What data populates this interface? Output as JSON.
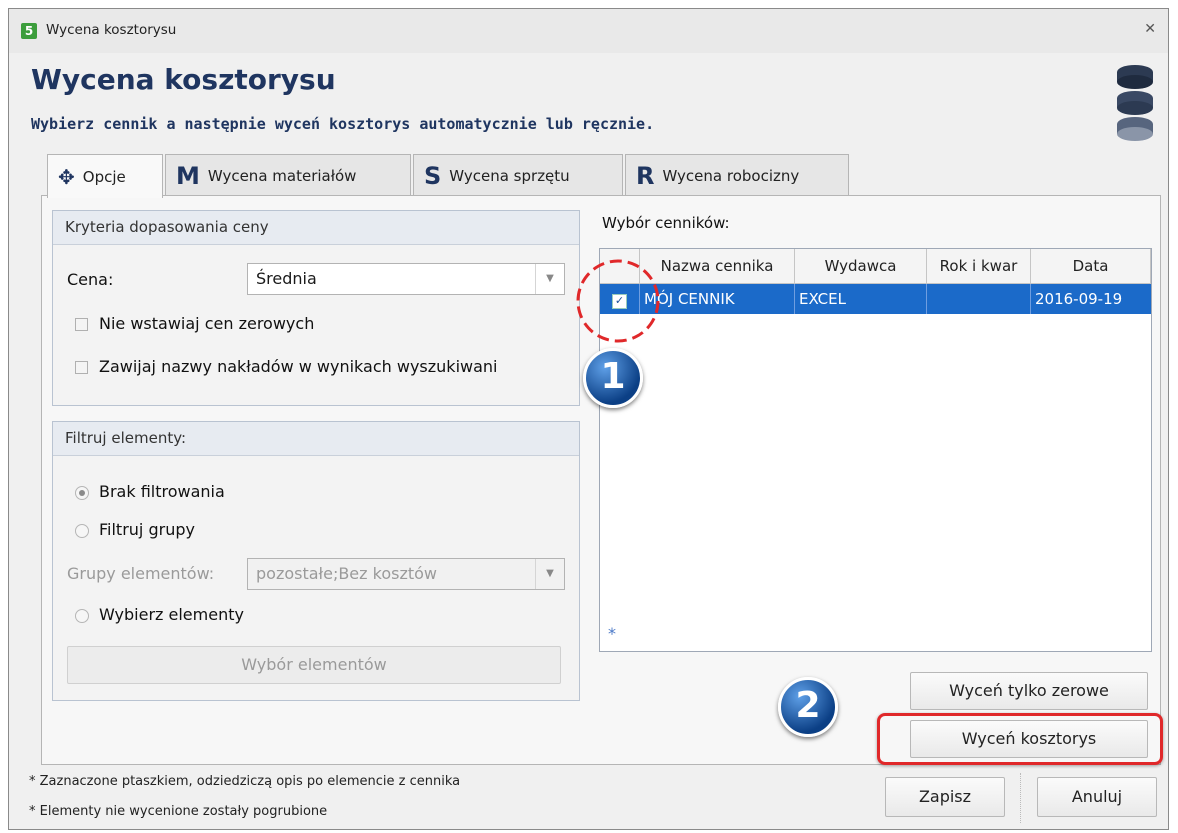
{
  "window": {
    "title": "Wycena kosztorysu",
    "app_icon": "5",
    "close_glyph": "✕"
  },
  "header": {
    "title": "Wycena kosztorysu",
    "subtitle": "Wybierz cennik a następnie wyceń kosztorys automatycznie lub ręcznie."
  },
  "tabs": [
    {
      "label": "Opcje",
      "icon": "✥"
    },
    {
      "label": "Wycena materiałów",
      "icon": "M"
    },
    {
      "label": "Wycena sprzętu",
      "icon": "S"
    },
    {
      "label": "Wycena robocizny",
      "icon": "R"
    }
  ],
  "criteria": {
    "heading": "Kryteria dopasowania ceny",
    "price_label": "Cena:",
    "price_value": "Średnia",
    "no_zero_label": "Nie wstawiaj cen zerowych",
    "wrap_names_label": "Zawijaj nazwy nakładów w wynikach wyszukiwani"
  },
  "filter": {
    "heading": "Filtruj elementy:",
    "option_none": "Brak filtrowania",
    "option_groups": "Filtruj grupy",
    "groups_label": "Grupy elementów:",
    "groups_value": "pozostałe;Bez kosztów",
    "option_select": "Wybierz elementy",
    "select_button": "Wybór elementów"
  },
  "pricelists": {
    "heading": "Wybór cenników:",
    "columns": [
      "Nazwa cennika",
      "Wydawca",
      "Rok i kwar",
      "Data"
    ],
    "rows": [
      {
        "checked": true,
        "name": "MÓJ CENNIK",
        "publisher": "EXCEL",
        "year_quarter": "",
        "date": "2016-09-19"
      }
    ],
    "new_row_marker": "*"
  },
  "buttons": {
    "price_zero_only": "Wyceń tylko zerowe",
    "price_estimate": "Wyceń kosztorys",
    "save": "Zapisz",
    "cancel": "Anuluj"
  },
  "footnotes": [
    "* Zaznaczone ptaszkiem,  odziedziczą opis po elemencie z cennika",
    "* Elementy nie wycenione zostały pogrubione"
  ],
  "badges": [
    "1",
    "2"
  ],
  "colors": {
    "selection": "#1b6ac9",
    "header_text": "#1f3560",
    "highlight": "#e0282a"
  }
}
